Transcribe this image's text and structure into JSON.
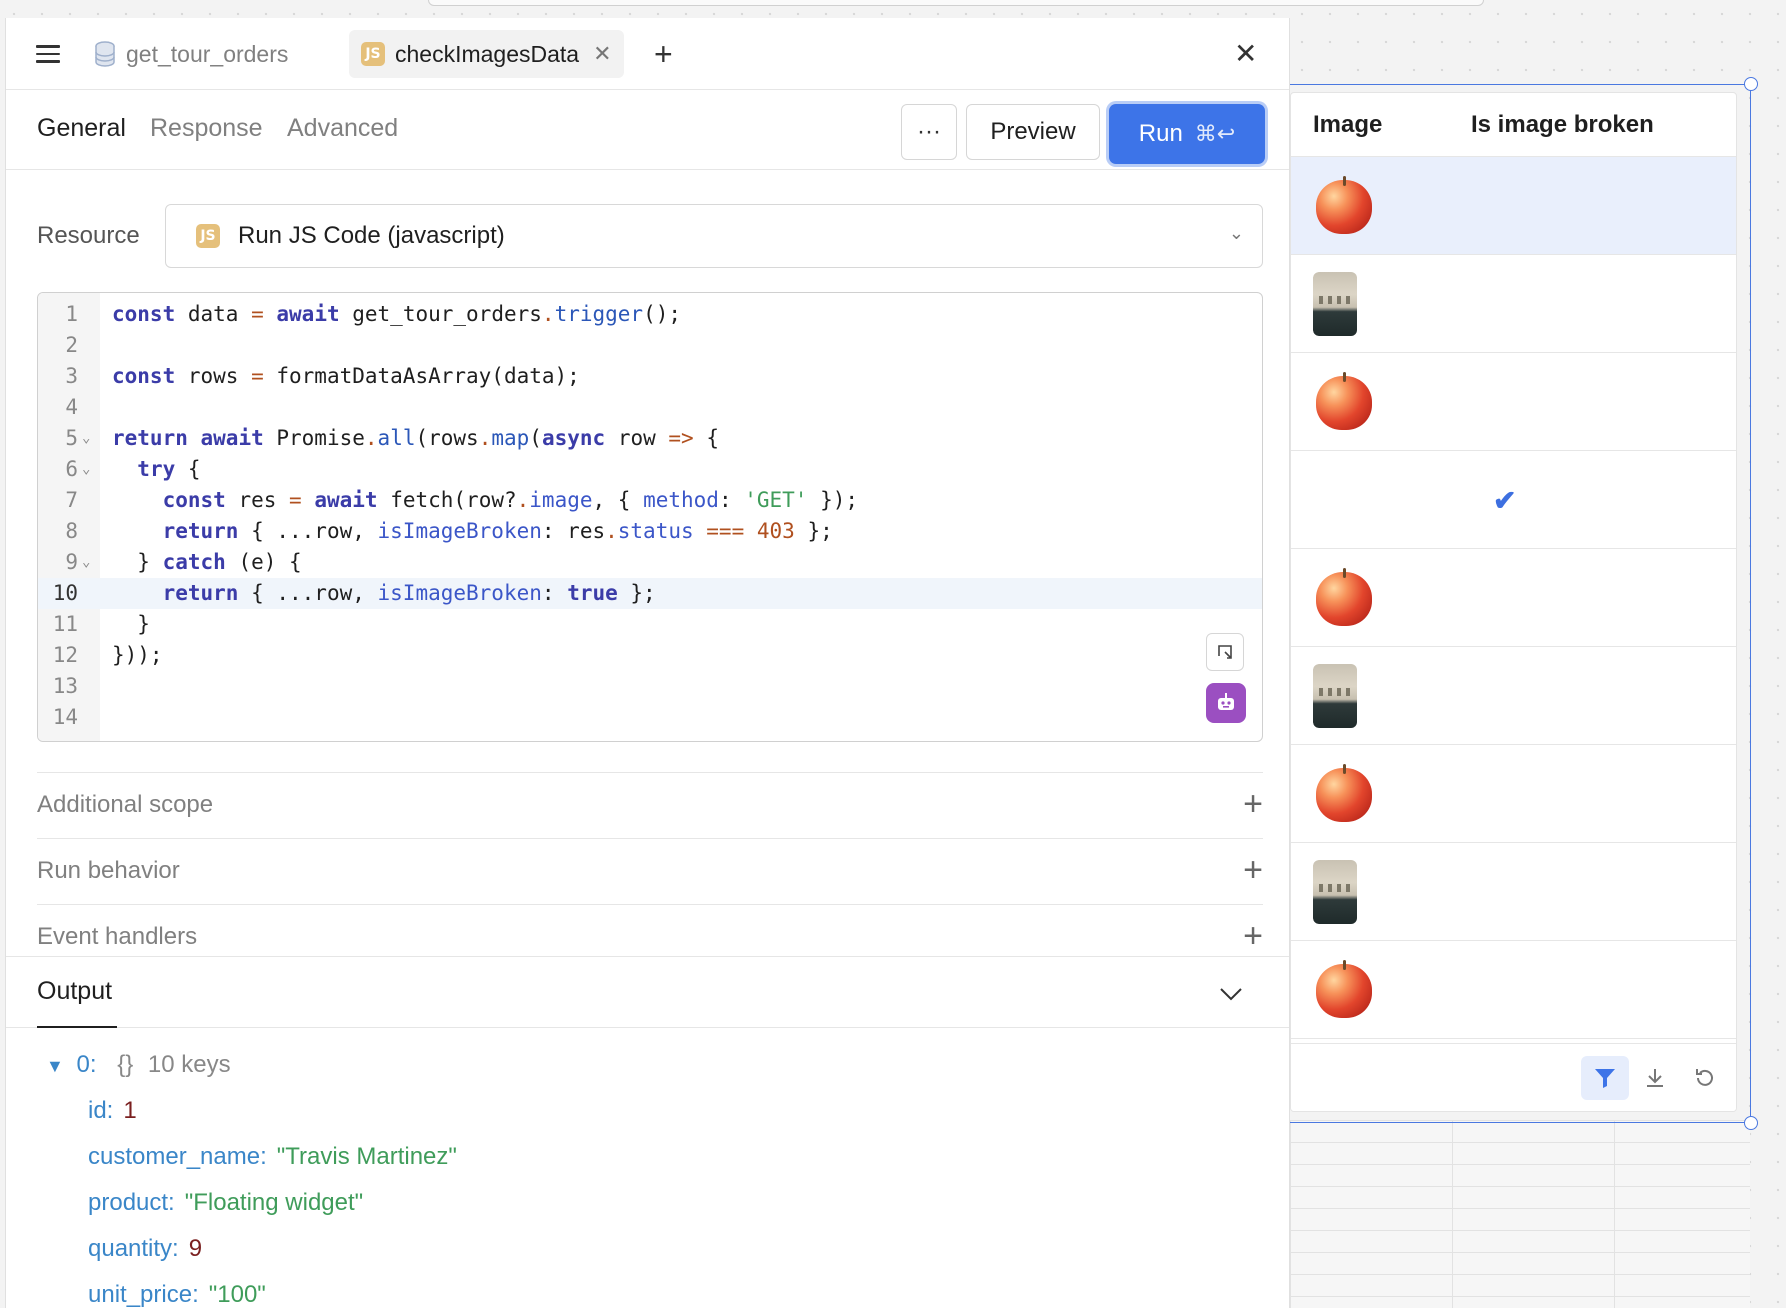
{
  "tabs": [
    {
      "label": "get_tour_orders",
      "type": "database",
      "active": false
    },
    {
      "label": "checkImagesData",
      "type": "js",
      "active": true
    }
  ],
  "js_badge_text": "JS",
  "subtabs": [
    {
      "label": "General",
      "active": true
    },
    {
      "label": "Response",
      "active": false
    },
    {
      "label": "Advanced",
      "active": false
    }
  ],
  "buttons": {
    "more": "···",
    "preview": "Preview",
    "run": "Run",
    "run_shortcut": "⌘↩"
  },
  "resource": {
    "label": "Resource",
    "value": "Run JS Code (javascript)"
  },
  "editor": {
    "line_numbers": [
      "1",
      "2",
      "3",
      "4",
      "5",
      "6",
      "7",
      "8",
      "9",
      "10",
      "11",
      "12",
      "13",
      "14"
    ],
    "active_line": "10"
  },
  "sections": [
    {
      "label": "Additional scope"
    },
    {
      "label": "Run behavior"
    },
    {
      "label": "Event handlers"
    }
  ],
  "output": {
    "tab_label": "Output",
    "root_key": "0:",
    "root_meta": "{}",
    "root_count": "10 keys",
    "fields": [
      {
        "key": "id:",
        "value": "1",
        "type": "number"
      },
      {
        "key": "customer_name:",
        "value": "\"Travis Martinez\"",
        "type": "string"
      },
      {
        "key": "product:",
        "value": "\"Floating widget\"",
        "type": "string"
      },
      {
        "key": "quantity:",
        "value": "9",
        "type": "number"
      },
      {
        "key": "unit_price:",
        "value": "\"100\"",
        "type": "string"
      }
    ]
  },
  "table": {
    "columns": [
      "Image",
      "Is image broken"
    ],
    "rows": [
      {
        "image": "apple",
        "broken": false,
        "selected": true
      },
      {
        "image": "room",
        "broken": false,
        "selected": false
      },
      {
        "image": "apple",
        "broken": false,
        "selected": false
      },
      {
        "image": "none",
        "broken": true,
        "selected": false
      },
      {
        "image": "apple",
        "broken": false,
        "selected": false
      },
      {
        "image": "room",
        "broken": false,
        "selected": false
      },
      {
        "image": "apple",
        "broken": false,
        "selected": false
      },
      {
        "image": "room",
        "broken": false,
        "selected": false
      },
      {
        "image": "apple",
        "broken": false,
        "selected": false
      }
    ],
    "check_mark": "✔"
  },
  "colors": {
    "accent": "#3d74e8",
    "selection": "#4a78e0",
    "js_badge": "#e5c07b",
    "assist_bot": "#9b4fc1"
  },
  "icons": {
    "menu": "hamburger-icon",
    "database": "database-icon",
    "tab_close": "close-icon",
    "new_tab": "plus-icon",
    "panel_close": "close-icon",
    "dropdown": "chevron-down-icon",
    "minimap": "expand-icon",
    "assist": "robot-icon",
    "section_expand": "plus-icon",
    "output_toggle": "chevron-down-icon",
    "filter": "filter-icon",
    "download": "download-icon",
    "refresh": "refresh-icon"
  }
}
